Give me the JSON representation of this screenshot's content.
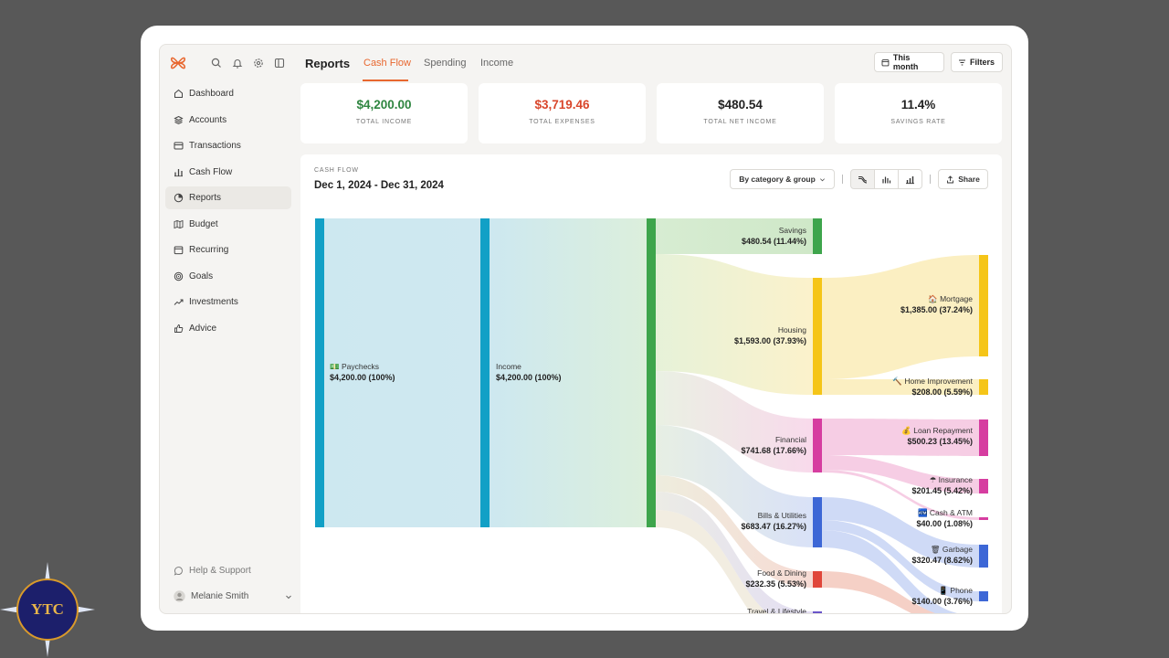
{
  "app": {
    "page_title": "Reports",
    "tabs": [
      {
        "label": "Cash Flow",
        "active": true
      },
      {
        "label": "Spending",
        "active": false
      },
      {
        "label": "Income",
        "active": false
      }
    ],
    "this_month_label": "This month",
    "filters_label": "Filters",
    "accent_color": "#e8672f"
  },
  "sidebar": {
    "items": [
      {
        "label": "Dashboard",
        "icon": "home-icon"
      },
      {
        "label": "Accounts",
        "icon": "layers-icon"
      },
      {
        "label": "Transactions",
        "icon": "card-icon"
      },
      {
        "label": "Cash Flow",
        "icon": "bar-chart-icon"
      },
      {
        "label": "Reports",
        "icon": "pie-icon",
        "active": true
      },
      {
        "label": "Budget",
        "icon": "map-icon"
      },
      {
        "label": "Recurring",
        "icon": "calendar-icon"
      },
      {
        "label": "Goals",
        "icon": "target-icon"
      },
      {
        "label": "Investments",
        "icon": "trend-icon"
      },
      {
        "label": "Advice",
        "icon": "thumbs-up-icon"
      }
    ],
    "help_label": "Help & Support",
    "user_name": "Melanie Smith"
  },
  "stats": [
    {
      "value": "$4,200.00",
      "label": "TOTAL INCOME",
      "color": "#2e8540"
    },
    {
      "value": "$3,719.46",
      "label": "TOTAL EXPENSES",
      "color": "#d9462b"
    },
    {
      "value": "$480.54",
      "label": "TOTAL NET INCOME",
      "color": "#222222"
    },
    {
      "value": "11.4%",
      "label": "SAVINGS RATE",
      "color": "#222222"
    }
  ],
  "cashflow": {
    "section_label": "CASH FLOW",
    "date_range": "Dec 1, 2024 - Dec 31, 2024",
    "group_by_label": "By category & group",
    "share_label": "Share",
    "nodes": {
      "paychecks": {
        "name": "💵 Paychecks",
        "amount": "$4,200.00 (100%)"
      },
      "income": {
        "name": "Income",
        "amount": "$4,200.00 (100%)"
      },
      "savings": {
        "name": "Savings",
        "amount": "$480.54 (11.44%)"
      },
      "housing": {
        "name": "Housing",
        "amount": "$1,593.00 (37.93%)"
      },
      "financial": {
        "name": "Financial",
        "amount": "$741.68 (17.66%)"
      },
      "bills": {
        "name": "Bills & Utilities",
        "amount": "$683.47 (16.27%)"
      },
      "food": {
        "name": "Food & Dining",
        "amount": "$232.35 (5.53%)"
      },
      "travel": {
        "name": "Travel & Lifestyle"
      },
      "mortgage": {
        "name": "🏠 Mortgage",
        "amount": "$1,385.00 (37.24%)"
      },
      "home_improvement": {
        "name": "🔨 Home Improvement",
        "amount": "$208.00 (5.59%)"
      },
      "loan": {
        "name": "💰 Loan Repayment",
        "amount": "$500.23 (13.45%)"
      },
      "insurance": {
        "name": "☂ Insurance",
        "amount": "$201.45 (5.42%)"
      },
      "cash_atm": {
        "name": "🏧 Cash & ATM",
        "amount": "$40.00 (1.08%)"
      },
      "garbage": {
        "name": "🗑 Garbage",
        "amount": "$320.47 (8.62%)"
      },
      "phone": {
        "name": "📱 Phone",
        "amount": "$140.00 (3.76%)"
      }
    }
  },
  "watermark": {
    "text": "YTC"
  }
}
